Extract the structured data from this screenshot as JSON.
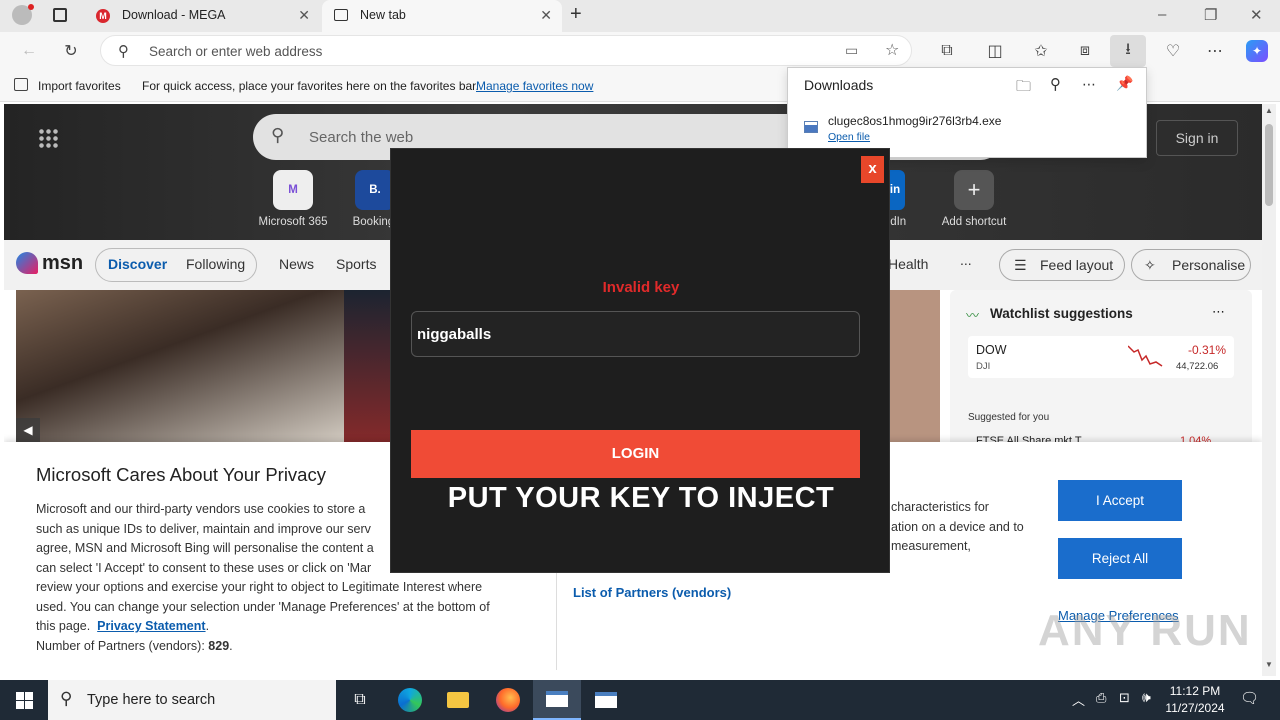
{
  "browser": {
    "tabs": [
      {
        "title": "Download - MEGA"
      },
      {
        "title": "New tab"
      }
    ],
    "address_placeholder": "Search or enter web address",
    "favorites_bar": {
      "import_label": "Import favorites",
      "hint": "For quick access, place your favorites here on the favorites bar.",
      "manage_link": "Manage favorites now"
    }
  },
  "downloads_panel": {
    "title": "Downloads",
    "file_name": "clugec8os1hmog9ir276l3rb4.exe",
    "open_file": "Open file"
  },
  "newtab": {
    "search_placeholder": "Search the web",
    "sign_in": "Sign in",
    "shortcuts": [
      {
        "label": "Microsoft 365",
        "icon": "M"
      },
      {
        "label": "Booking.",
        "icon": "B."
      },
      {
        "label": "edIn",
        "icon": "in"
      },
      {
        "label": "Add shortcut",
        "icon": "+"
      }
    ],
    "msn": {
      "logo": "msn",
      "nav": [
        "Discover",
        "Following",
        "News",
        "Sports",
        "Health"
      ],
      "more": "...",
      "feed_layout": "Feed layout",
      "personalise": "Personalise"
    },
    "watchlist": {
      "title": "Watchlist suggestions",
      "stock_name": "DOW",
      "stock_sub": "DJI",
      "change": "-0.31%",
      "value": "44,722.06",
      "suggested": "Suggested for you",
      "next_stock": "FTSE All Share mkt T",
      "next_change": "1.04%"
    }
  },
  "privacy": {
    "title": "Microsoft Cares About Your Privacy",
    "body_lines": [
      "Microsoft and our third-party vendors use cookies to store a",
      "such as unique IDs to deliver, maintain and improve our serv",
      "agree, MSN and Microsoft Bing will personalise the content a",
      "can select 'I Accept' to consent to these uses or click on 'Mar",
      "review your options and exercise your right to object to Legitimate Interest where",
      "used.  You can change your selection under 'Manage Preferences' at the bottom of",
      "this page."
    ],
    "privacy_statement": "Privacy Statement",
    "partners_label": "Number of Partners (vendors):",
    "partners_count": "829",
    "right_lines": [
      "characteristics for",
      "ation on a device and to",
      "measurement,"
    ],
    "list_partners": "List of Partners (vendors)",
    "accept": "I Accept",
    "reject": "Reject All",
    "manage": "Manage Preferences"
  },
  "injector": {
    "close": "x",
    "error": "Invalid key",
    "key_value": "niggaballs",
    "login": "LOGIN",
    "instruction": "PUT YOUR KEY TO INJECT"
  },
  "taskbar": {
    "search_placeholder": "Type here to search",
    "time": "11:12 PM",
    "date": "11/27/2024"
  },
  "watermark": "ANY RUN",
  "colors": {
    "modal_bg": "#1e1e1e",
    "login_button": "#f04b36",
    "error_text": "#e02a2a",
    "accept_blue": "#1a6dcc"
  }
}
